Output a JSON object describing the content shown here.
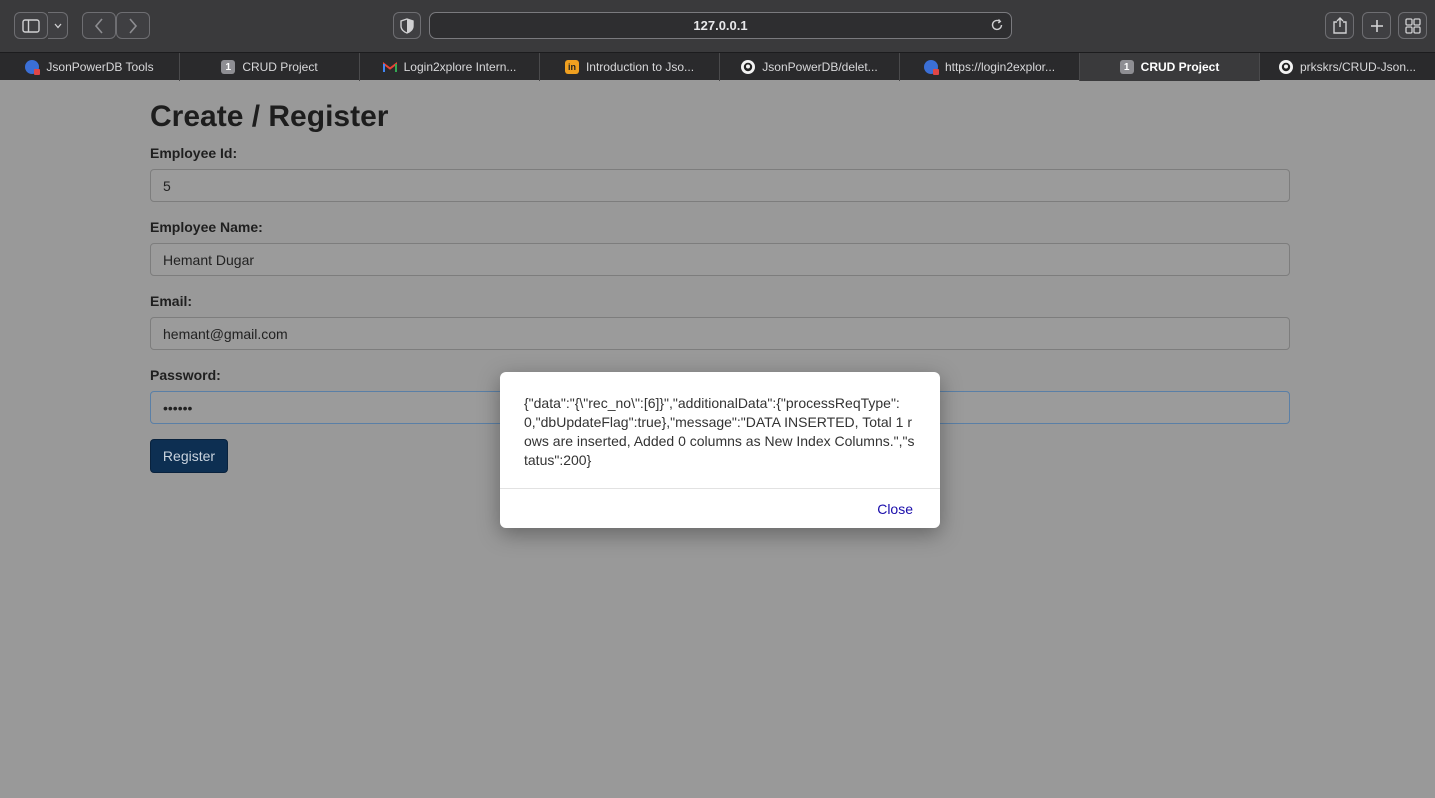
{
  "browser": {
    "address": "127.0.0.1",
    "tabs": [
      {
        "label": "JsonPowerDB Tools",
        "icon": "jpdb-icon"
      },
      {
        "label": "CRUD Project",
        "icon": "number-1-icon",
        "badge": "1"
      },
      {
        "label": "Login2xplore Intern...",
        "icon": "gmail-icon"
      },
      {
        "label": "Introduction to Jso...",
        "icon": "in-icon",
        "badge": "in"
      },
      {
        "label": "JsonPowerDB/delet...",
        "icon": "github-icon"
      },
      {
        "label": "https://login2explor...",
        "icon": "jpdb-icon"
      },
      {
        "label": "CRUD Project",
        "icon": "number-1-icon",
        "badge": "1",
        "active": true
      },
      {
        "label": "prkskrs/CRUD-Json...",
        "icon": "github-icon"
      }
    ]
  },
  "form": {
    "title": "Create / Register",
    "employee_id": {
      "label": "Employee Id:",
      "value": "5"
    },
    "employee_name": {
      "label": "Employee Name:",
      "value": "Hemant Dugar"
    },
    "email": {
      "label": "Email:",
      "value": "hemant@gmail.com"
    },
    "password": {
      "label": "Password:",
      "value": "••••••"
    },
    "register_label": "Register"
  },
  "modal": {
    "message": "{\"data\":\"{\\\"rec_no\\\":[6]}\",\"additionalData\":{\"processReqType\":0,\"dbUpdateFlag\":true},\"message\":\"DATA INSERTED, Total 1 rows are inserted, Added 0 columns as New Index Columns.\",\"status\":200}",
    "close_label": "Close"
  }
}
